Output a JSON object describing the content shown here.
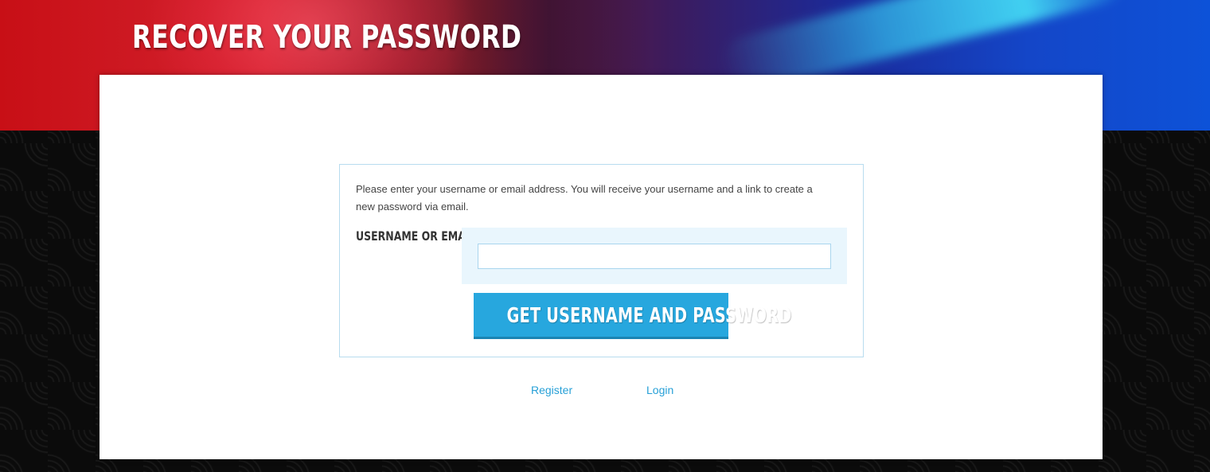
{
  "header": {
    "title": "RECOVER YOUR PASSWORD"
  },
  "form": {
    "instructions": "Please enter your username or email address. You will receive your username and a link to create a new password via email.",
    "field_label": "USERNAME OR EMAIL",
    "field_value": "",
    "submit_label": "GET USERNAME AND PASSWORD"
  },
  "links": {
    "register": "Register",
    "login": "Login"
  },
  "colors": {
    "accent": "#27a7de",
    "link": "#27a0d7",
    "field_background": "#e9f6fd",
    "border": "#b8dcef"
  }
}
